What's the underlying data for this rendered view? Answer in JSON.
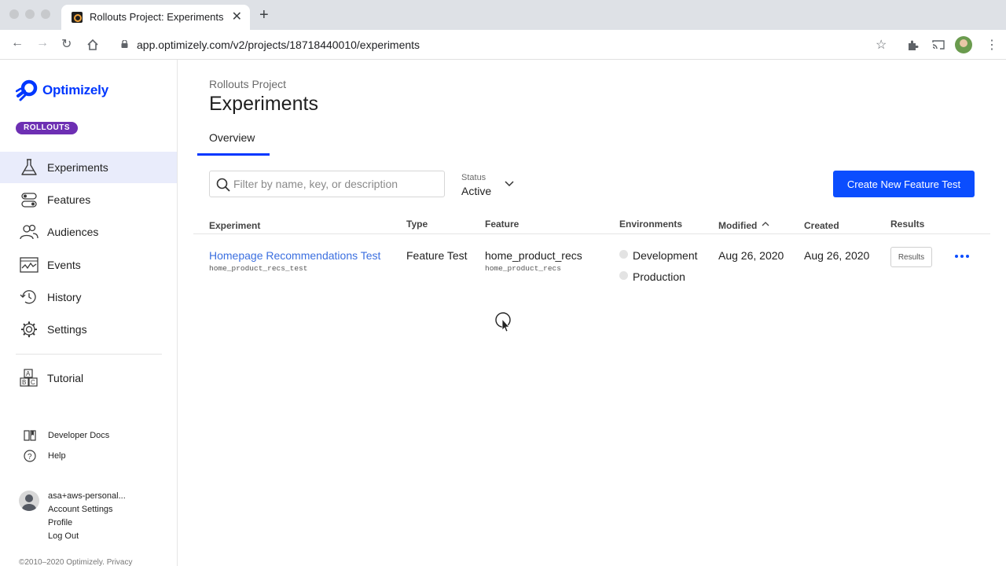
{
  "browser": {
    "tab_title": "Rollouts Project: Experiments - ",
    "url": "app.optimizely.com/v2/projects/18718440010/experiments"
  },
  "sidebar": {
    "brand": "Optimizely",
    "badge": "ROLLOUTS",
    "items": [
      {
        "label": "Experiments",
        "icon": "flask-icon",
        "active": true
      },
      {
        "label": "Features",
        "icon": "toggles-icon"
      },
      {
        "label": "Audiences",
        "icon": "people-icon"
      },
      {
        "label": "Events",
        "icon": "chart-icon"
      },
      {
        "label": "History",
        "icon": "history-icon"
      },
      {
        "label": "Settings",
        "icon": "gear-icon"
      },
      {
        "label": "Tutorial",
        "icon": "abc-blocks-icon"
      }
    ],
    "links": [
      {
        "label": "Developer Docs",
        "icon": "book-icon"
      },
      {
        "label": "Help",
        "icon": "help-icon"
      }
    ],
    "account": {
      "user": "asa+aws-personal...",
      "settings": "Account Settings",
      "profile": "Profile",
      "logout": "Log Out"
    },
    "copyright": "©2010–2020 Optimizely. Privacy"
  },
  "main": {
    "breadcrumb": "Rollouts Project",
    "title": "Experiments",
    "tab": "Overview",
    "search_placeholder": "Filter by name, key, or description",
    "status_label": "Status",
    "status_value": "Active",
    "create_button": "Create New Feature Test",
    "columns": {
      "experiment": "Experiment",
      "type": "Type",
      "feature": "Feature",
      "environments": "Environments",
      "modified": "Modified",
      "created": "Created",
      "results": "Results"
    },
    "rows": [
      {
        "name": "Homepage Recommendations Test",
        "key": "home_product_recs_test",
        "type": "Feature Test",
        "feature": "home_product_recs",
        "feature_key": "home_product_recs",
        "environments": [
          "Development",
          "Production"
        ],
        "modified": "Aug 26, 2020",
        "created": "Aug 26, 2020",
        "results_button": "Results"
      }
    ]
  },
  "colors": {
    "brand_blue": "#0037ff",
    "button_blue": "#0b4dfe",
    "link_blue": "#3b6fe0",
    "badge_purple": "#6d2fb3",
    "active_bg": "#e9ecfb"
  }
}
